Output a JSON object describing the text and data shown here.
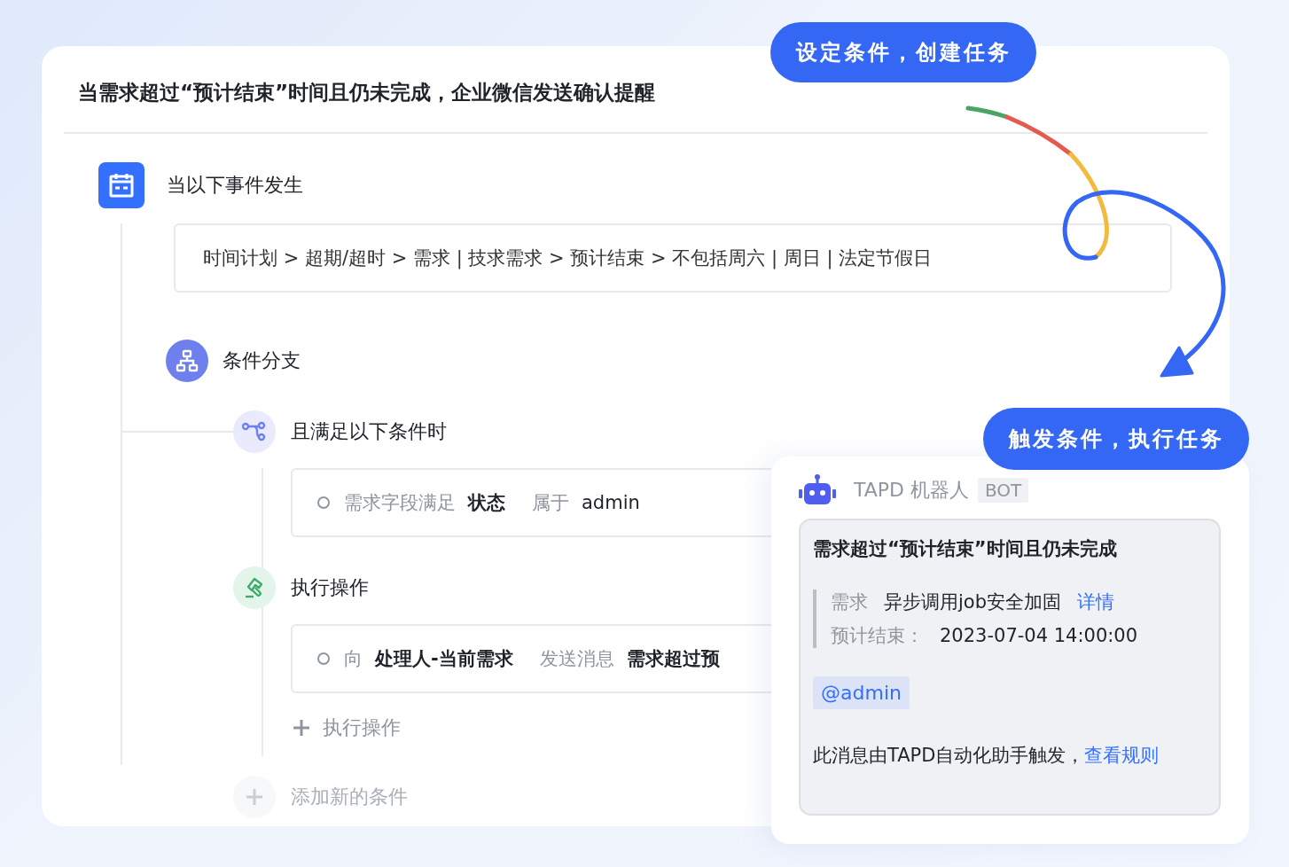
{
  "rule_card": {
    "title": "当需求超过“预计结束”时间且仍未完成，企业微信发送确认提醒",
    "trigger": {
      "label": "当以下事件发生",
      "event_path": "时间计划 > 超期/超时 > 需求 | 技求需求 > 预计结束 > 不包括周六 | 周日 | 法定节假日"
    },
    "branch": {
      "label": "条件分支",
      "condition": {
        "label": "且满足以下条件时",
        "parts": [
          {
            "text": "需求字段满足",
            "kind": "muted"
          },
          {
            "text": "状态",
            "kind": "value"
          },
          {
            "text": "属于",
            "kind": "muted"
          },
          {
            "text": "admin",
            "kind": "plain"
          }
        ]
      },
      "action": {
        "label": "执行操作",
        "parts": [
          {
            "text": "向",
            "kind": "muted"
          },
          {
            "text": "处理人-当前需求",
            "kind": "value"
          },
          {
            "text": "发送消息",
            "kind": "muted"
          },
          {
            "text": "需求超过预",
            "kind": "value"
          }
        ]
      },
      "add_action": "执行操作",
      "add_condition": "添加新的条件"
    }
  },
  "callouts": [
    "设定条件，创建任务",
    "触发条件，执行任务"
  ],
  "bot_message": {
    "sender": "TAPD 机器人",
    "tag": "BOT",
    "title": "需求超过“预计结束”时间且仍未完成",
    "fields": [
      {
        "label": "需求",
        "value": "异步调用job安全加固",
        "link": "详情"
      },
      {
        "label": "预计结束：",
        "value": "2023-07-04 14:00:00"
      }
    ],
    "mention": "@admin",
    "footer": "此消息由TAPD自动化助手触发，",
    "footer_link": "查看规则"
  }
}
